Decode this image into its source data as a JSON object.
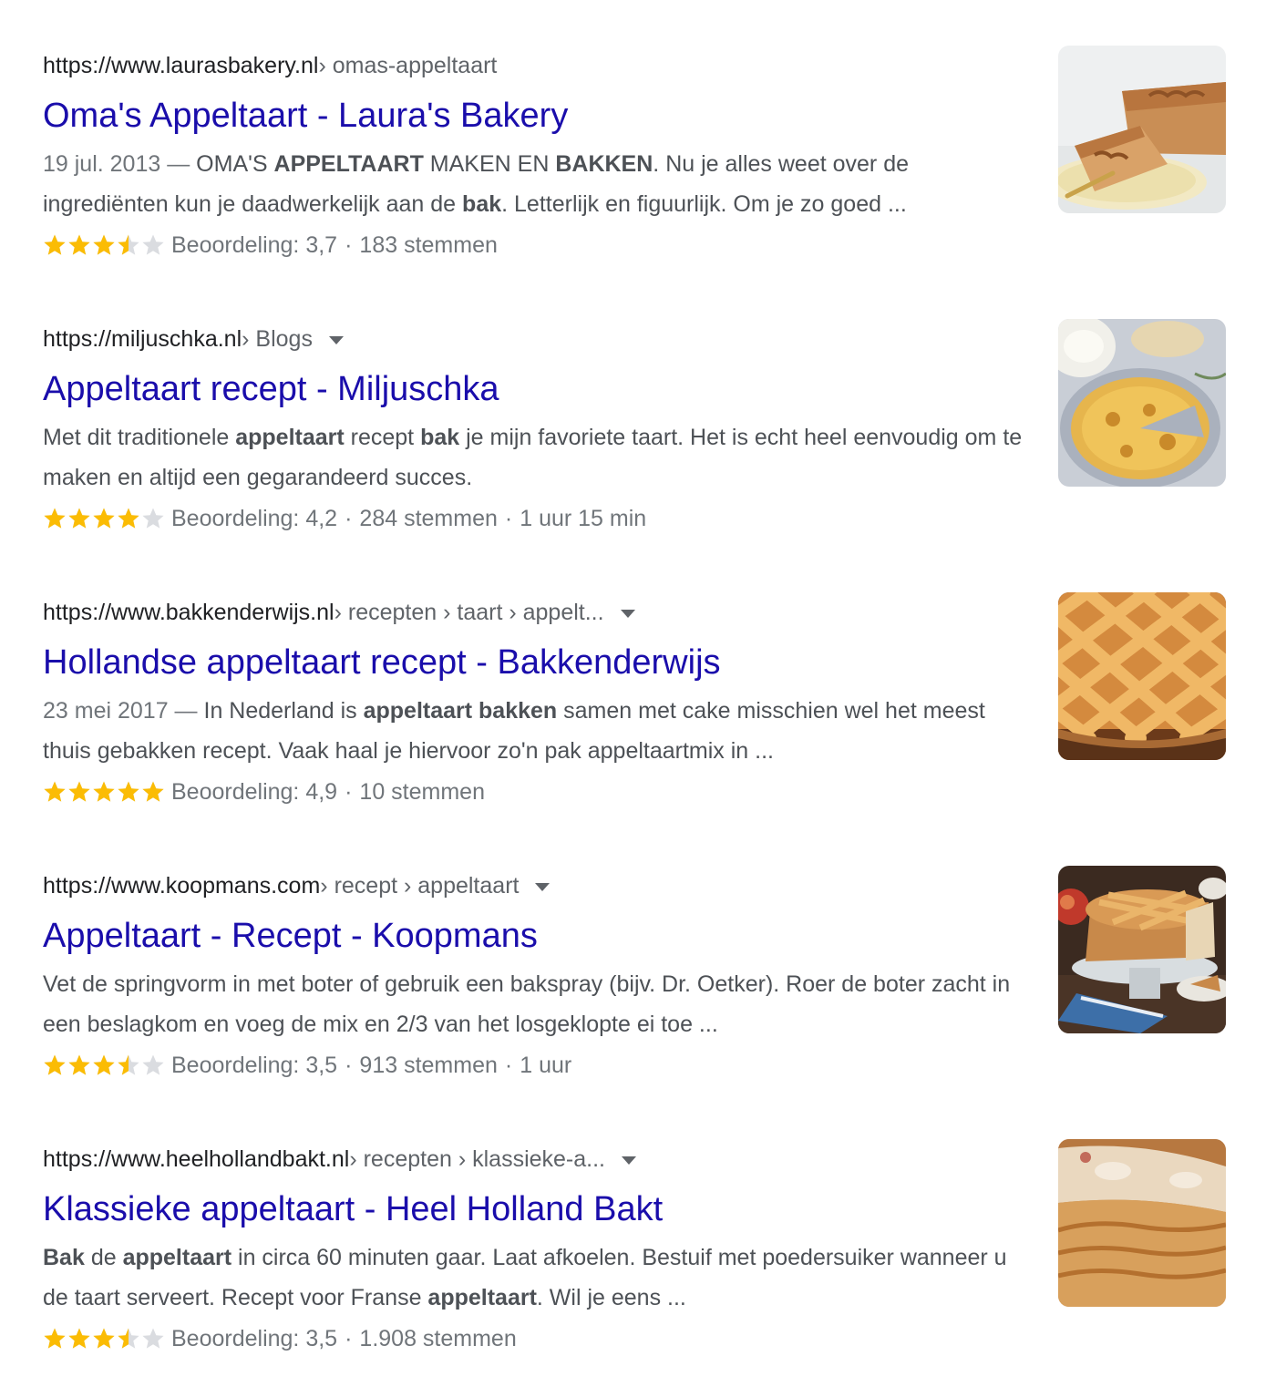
{
  "results": [
    {
      "url_domain": "https://www.laurasbakery.nl",
      "url_path": " › omas-appeltaart",
      "has_menu": false,
      "title": "Oma's Appeltaart - Laura's Bakery",
      "snippet_parts": [
        {
          "t": "19 jul. 2013 — ",
          "s": "date"
        },
        {
          "t": "OMA'S "
        },
        {
          "t": "APPELTAART",
          "s": "b"
        },
        {
          "t": " MAKEN EN "
        },
        {
          "t": "BAKKEN",
          "s": "b"
        },
        {
          "t": ". Nu je alles weet over de ingrediënten kun je daadwerkelijk aan de "
        },
        {
          "t": "bak",
          "s": "b"
        },
        {
          "t": ". Letterlijk en figuurlijk. Om je zo goed ..."
        }
      ],
      "stars": 3.5,
      "rating_label": "Beoordeling: 3,7",
      "votes": "183 stemmen",
      "duration": "",
      "thumb_icon": "apple-pie-slice-plate-thumbnail"
    },
    {
      "url_domain": "https://miljuschka.nl",
      "url_path": " › Blogs",
      "has_menu": true,
      "title": "Appeltaart recept - Miljuschka",
      "snippet_parts": [
        {
          "t": "Met dit traditionele "
        },
        {
          "t": "appeltaart",
          "s": "b"
        },
        {
          "t": " recept "
        },
        {
          "t": "bak",
          "s": "b"
        },
        {
          "t": " je mijn favoriete taart. Het is echt heel eenvoudig om te maken en altijd een gegarandeerd succes."
        }
      ],
      "stars": 4,
      "rating_label": "Beoordeling: 4,2",
      "votes": "284 stemmen",
      "duration": "1 uur 15 min",
      "thumb_icon": "apple-pie-top-view-thumbnail"
    },
    {
      "url_domain": "https://www.bakkenderwijs.nl",
      "url_path": " › recepten › taart › appelt...",
      "has_menu": true,
      "title": "Hollandse appeltaart recept - Bakkenderwijs",
      "snippet_parts": [
        {
          "t": "23 mei 2017 — ",
          "s": "date"
        },
        {
          "t": "In Nederland is "
        },
        {
          "t": "appeltaart bakken",
          "s": "b"
        },
        {
          "t": " samen met cake misschien wel het meest thuis gebakken recept. Vaak haal je hiervoor zo'n pak appeltaartmix in ..."
        }
      ],
      "stars": 5,
      "rating_label": "Beoordeling: 4,9",
      "votes": "10 stemmen",
      "duration": "",
      "thumb_icon": "lattice-apple-pie-thumbnail"
    },
    {
      "url_domain": "https://www.koopmans.com",
      "url_path": " › recept › appeltaart",
      "has_menu": true,
      "title": "Appeltaart - Recept - Koopmans",
      "snippet_parts": [
        {
          "t": "Vet de springvorm in met boter of gebruik een bakspray (bijv. Dr. Oetker). Roer de boter zacht in een beslagkom en voeg de mix en 2/3 van het losgeklopte ei toe ..."
        }
      ],
      "stars": 3.5,
      "rating_label": "Beoordeling: 3,5",
      "votes": "913 stemmen",
      "duration": "1 uur",
      "thumb_icon": "apple-pie-cake-stand-thumbnail"
    },
    {
      "url_domain": "https://www.heelhollandbakt.nl",
      "url_path": " › recepten › klassieke-a...",
      "has_menu": true,
      "title": "Klassieke appeltaart - Heel Holland Bakt",
      "snippet_parts": [
        {
          "t": "Bak",
          "s": "b"
        },
        {
          "t": " de "
        },
        {
          "t": "appeltaart",
          "s": "b"
        },
        {
          "t": " in circa 60 minuten gaar. Laat afkoelen. Bestuif met poedersuiker wanneer u de taart serveert. Recept voor Franse "
        },
        {
          "t": "appeltaart",
          "s": "b"
        },
        {
          "t": ". Wil je eens ..."
        }
      ],
      "stars": 3.5,
      "rating_label": "Beoordeling: 3,5",
      "votes": "1.908 stemmen",
      "duration": "",
      "thumb_icon": "apple-pie-slice-closeup-thumbnail"
    }
  ],
  "colors": {
    "title_link": "#1a0dab",
    "star_filled": "#fbbc04",
    "star_empty": "#dadce0",
    "snippet_text": "#4d5156",
    "meta_text": "#70757a"
  }
}
